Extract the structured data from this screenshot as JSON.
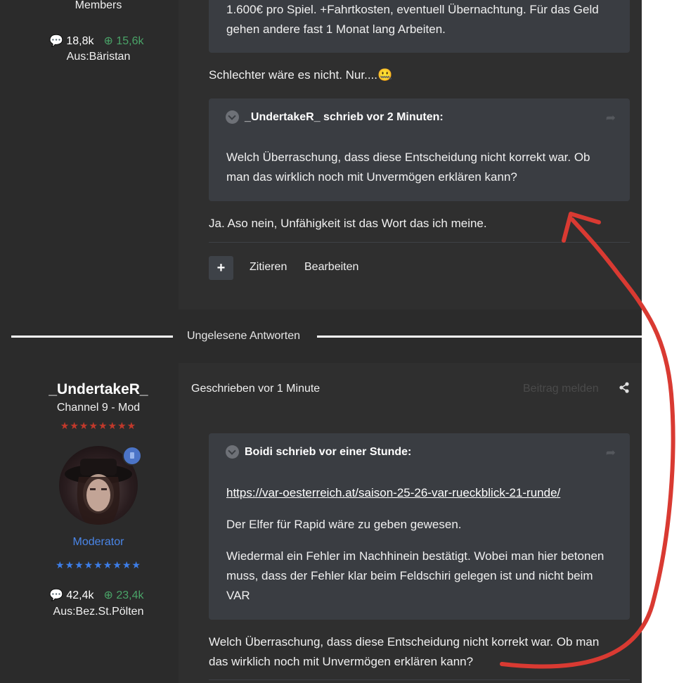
{
  "post1": {
    "author_group": "Members",
    "posts_count": "18,8k",
    "rep_count": "15,6k",
    "location": "Aus:Bäristan",
    "quote_tail_line1": "1.600€ pro Spiel. +Fahrtkosten, eventuell Übernachtung. Für das Geld",
    "quote_tail_line2": "gehen andere fast 1 Monat lang Arbeiten.",
    "reply_text": "Schlechter wäre es nicht. Nur....",
    "reply_emoji": "🤐",
    "quote2_header": "_UndertakeR_ schrieb vor 2 Minuten:",
    "quote2_line1": "Welch Überraschung, dass diese Entscheidung nicht korrekt war. Ob",
    "quote2_line2": "man das wirklich noch mit Unvermögen erklären kann?",
    "answer_text": "Ja. Aso nein, Unfähigkeit ist das Wort das ich meine.",
    "plus_label": "+",
    "quote_action": "Zitieren",
    "edit_action": "Bearbeiten"
  },
  "unread_label": "Ungelesene Antworten",
  "post2": {
    "username": "_UndertakeR_",
    "title": "Channel 9 - Mod",
    "red_stars": "★★★★★★★★",
    "group": "Moderator",
    "blue_stars": "★★★★★★★★★",
    "posts_count": "42,4k",
    "rep_count": "23,4k",
    "location": "Aus:Bez.St.Pölten",
    "posted": "Geschrieben vor 1 Minute",
    "report": "Beitrag melden",
    "quote_header": "Boidi schrieb vor einer Stunde:",
    "quote_link": "https://var-oesterreich.at/saison-25-26-var-rueckblick-21-runde/",
    "quote_para1": "Der Elfer für Rapid wäre zu geben gewesen.",
    "quote_para2_line1": "Wiedermal ein Fehler im Nachhinein bestätigt. Wobei man hier betonen",
    "quote_para2_line2": "muss, dass der Fehler klar beim Feldschiri gelegen ist und nicht beim",
    "quote_para2_line3": "VAR",
    "body_line1": "Welch Überraschung, dass diese Entscheidung nicht korrekt war. Ob man",
    "body_line2": "das wirklich noch mit Unvermögen erklären kann?"
  },
  "colors": {
    "background": "#2b2b2b",
    "post_background": "#2f2f2f",
    "quote_background": "#3a3d42",
    "reputation_green": "#4aa468",
    "moderator_blue": "#4a86e8",
    "annotation_red": "#d93a32"
  },
  "icons": {
    "posts": "comment-icon",
    "reputation": "plus-circle-icon",
    "quote_toggle": "chevron-down-icon",
    "quote_share": "share-arrow-icon",
    "post_share": "share-icon"
  }
}
